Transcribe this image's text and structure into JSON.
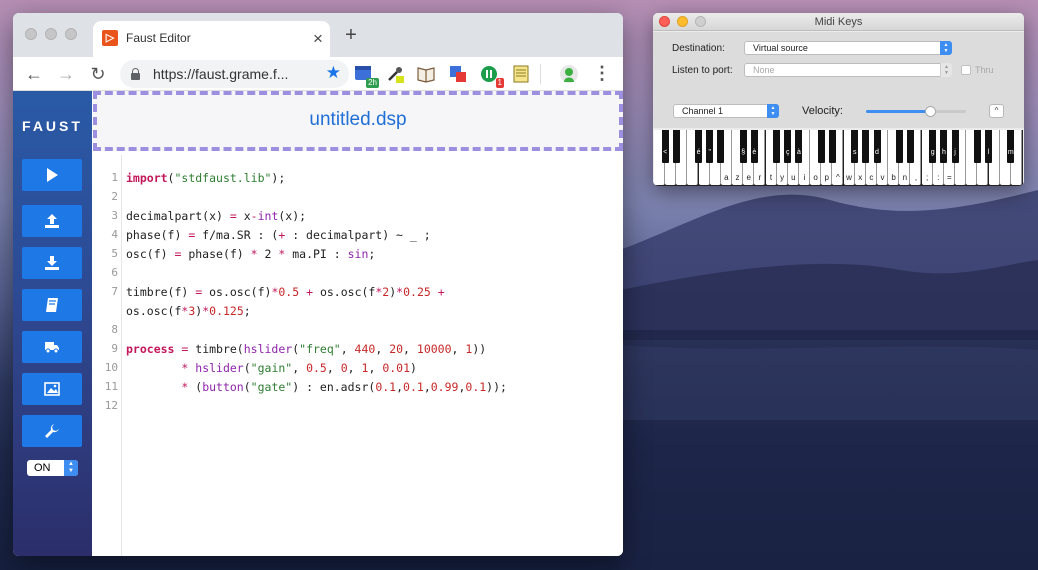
{
  "browser": {
    "tab_title": "Faust Editor",
    "tab_close": "×",
    "new_tab": "+",
    "url": "https://faust.grame.f...",
    "nav": {
      "back": "←",
      "forward": "→",
      "reload": "↻"
    },
    "star": "★",
    "menu": "⋮",
    "extensions": [
      {
        "icon": "calendar-ext-icon",
        "badge": "2h",
        "badge_color": "#2e9d4f"
      },
      {
        "icon": "eyedropper-ext-icon",
        "badge": "",
        "badge_color": ""
      },
      {
        "icon": "book-ext-icon",
        "badge": "",
        "badge_color": ""
      },
      {
        "icon": "translate-ext-icon",
        "badge": "",
        "badge_color": ""
      },
      {
        "icon": "record-ext-icon",
        "badge": "1",
        "badge_color": "#e53935"
      },
      {
        "icon": "notes-ext-icon",
        "badge": "",
        "badge_color": ""
      },
      {
        "icon": "profile-avatar-icon",
        "badge": "",
        "badge_color": ""
      }
    ]
  },
  "faust": {
    "logo": "FAUST",
    "filename": "untitled.dsp",
    "sidebar_buttons": [
      "run-button",
      "upload-button",
      "download-button",
      "docs-button",
      "export-button",
      "diagram-button",
      "settings-button"
    ],
    "power_select": {
      "value": "ON"
    },
    "colors": {
      "accent": "#1e78e6",
      "title": "#1f6fd6",
      "dash": "#9c8fe0"
    }
  },
  "code": {
    "line_numbers": [
      "1",
      "2",
      "3",
      "4",
      "5",
      "6",
      "7",
      "",
      "8",
      "9",
      "10",
      "11",
      "12"
    ],
    "lines": [
      [
        [
          "kw",
          "import"
        ],
        [
          "",
          "("
        ],
        [
          "str",
          "\"stdfaust.lib\""
        ],
        [
          "",
          ");"
        ]
      ],
      [],
      [
        [
          "",
          "decimalpart(x) "
        ],
        [
          "op",
          "="
        ],
        [
          "",
          " x"
        ],
        [
          "op",
          "-"
        ],
        [
          "fn",
          "int"
        ],
        [
          "",
          "(x);"
        ]
      ],
      [
        [
          "",
          "phase(f) "
        ],
        [
          "op",
          "="
        ],
        [
          "",
          " f/ma.SR : ("
        ],
        [
          "op",
          "+"
        ],
        [
          "",
          " : decimalpart) ~ _ ;"
        ]
      ],
      [
        [
          "",
          "osc(f) "
        ],
        [
          "op",
          "="
        ],
        [
          "",
          " phase(f) "
        ],
        [
          "op",
          "*"
        ],
        [
          "",
          " 2 "
        ],
        [
          "op",
          "*"
        ],
        [
          "",
          " ma.PI : "
        ],
        [
          "fn",
          "sin"
        ],
        [
          "",
          ";"
        ]
      ],
      [],
      [
        [
          "",
          "timbre(f) "
        ],
        [
          "op",
          "="
        ],
        [
          "",
          " os.osc(f)"
        ],
        [
          "op",
          "*"
        ],
        [
          "num",
          "0.5"
        ],
        [
          "",
          " "
        ],
        [
          "op",
          "+"
        ],
        [
          "",
          " os.osc(f"
        ],
        [
          "op",
          "*"
        ],
        [
          "num",
          "2"
        ],
        [
          "",
          ")"
        ],
        [
          "op",
          "*"
        ],
        [
          "num",
          "0.25"
        ],
        [
          "",
          " "
        ],
        [
          "op",
          "+"
        ]
      ],
      [
        [
          "",
          "os.osc(f"
        ],
        [
          "op",
          "*"
        ],
        [
          "num",
          "3"
        ],
        [
          "",
          ")"
        ],
        [
          "op",
          "*"
        ],
        [
          "num",
          "0.125"
        ],
        [
          "",
          ";"
        ]
      ],
      [],
      [
        [
          "kw",
          "process"
        ],
        [
          "",
          " "
        ],
        [
          "op",
          "="
        ],
        [
          "",
          " timbre("
        ],
        [
          "fn",
          "hslider"
        ],
        [
          "",
          "("
        ],
        [
          "str",
          "\"freq\""
        ],
        [
          "",
          ", "
        ],
        [
          "num",
          "440"
        ],
        [
          "",
          ", "
        ],
        [
          "num",
          "20"
        ],
        [
          "",
          ", "
        ],
        [
          "num",
          "10000"
        ],
        [
          "",
          ", "
        ],
        [
          "num",
          "1"
        ],
        [
          "",
          "))"
        ]
      ],
      [
        [
          "",
          "        "
        ],
        [
          "op",
          "*"
        ],
        [
          "",
          " "
        ],
        [
          "fn",
          "hslider"
        ],
        [
          "",
          "("
        ],
        [
          "str",
          "\"gain\""
        ],
        [
          "",
          ", "
        ],
        [
          "num",
          "0.5"
        ],
        [
          "",
          ", "
        ],
        [
          "num",
          "0"
        ],
        [
          "",
          ", "
        ],
        [
          "num",
          "1"
        ],
        [
          "",
          ", "
        ],
        [
          "num",
          "0.01"
        ],
        [
          "",
          ")"
        ]
      ],
      [
        [
          "",
          "        "
        ],
        [
          "op",
          "*"
        ],
        [
          "",
          " ("
        ],
        [
          "fn",
          "button"
        ],
        [
          "",
          "("
        ],
        [
          "str",
          "\"gate\""
        ],
        [
          "",
          ") : en.adsr("
        ],
        [
          "num",
          "0.1"
        ],
        [
          "",
          ","
        ],
        [
          "num",
          "0.1"
        ],
        [
          "",
          ","
        ],
        [
          "num",
          "0.99"
        ],
        [
          "",
          ","
        ],
        [
          "num",
          "0.1"
        ],
        [
          "",
          "));"
        ]
      ],
      []
    ]
  },
  "midi_keys": {
    "title": "Midi Keys",
    "destination_label": "Destination:",
    "destination_value": "Virtual source",
    "listen_label": "Listen to port:",
    "listen_value": "None",
    "thru_label": "Thru",
    "channel_value": "Channel 1",
    "velocity_label": "Velocity:",
    "velocity_level": 0.65,
    "collapse": "^",
    "white_key_labels": [
      "",
      "",
      "",
      "",
      "",
      "",
      "a",
      "z",
      "e",
      "r",
      "t",
      "y",
      "u",
      "i",
      "o",
      "p",
      "^",
      "w",
      "x",
      "c",
      "v",
      "b",
      "n",
      ",",
      ";",
      ":",
      "=",
      "",
      "",
      "",
      "",
      "",
      ""
    ],
    "black_key_labels": [
      "<",
      "",
      "é",
      "\"",
      "",
      "§",
      "è",
      "",
      "ç",
      "à",
      "",
      "",
      "s",
      "",
      "d",
      "",
      "",
      "g",
      "h",
      "j",
      "",
      "l",
      "m",
      "",
      ""
    ],
    "black_key_positions": [
      0.5,
      1.5,
      3.5,
      4.5,
      5.5,
      7.5,
      8.5,
      10.5,
      11.5,
      12.5,
      14.5,
      15.5,
      17.5,
      18.5,
      19.5,
      21.5,
      22.5,
      24.5,
      25.5,
      26.5,
      28.5,
      29.5,
      31.5
    ],
    "white_key_count": 33
  }
}
